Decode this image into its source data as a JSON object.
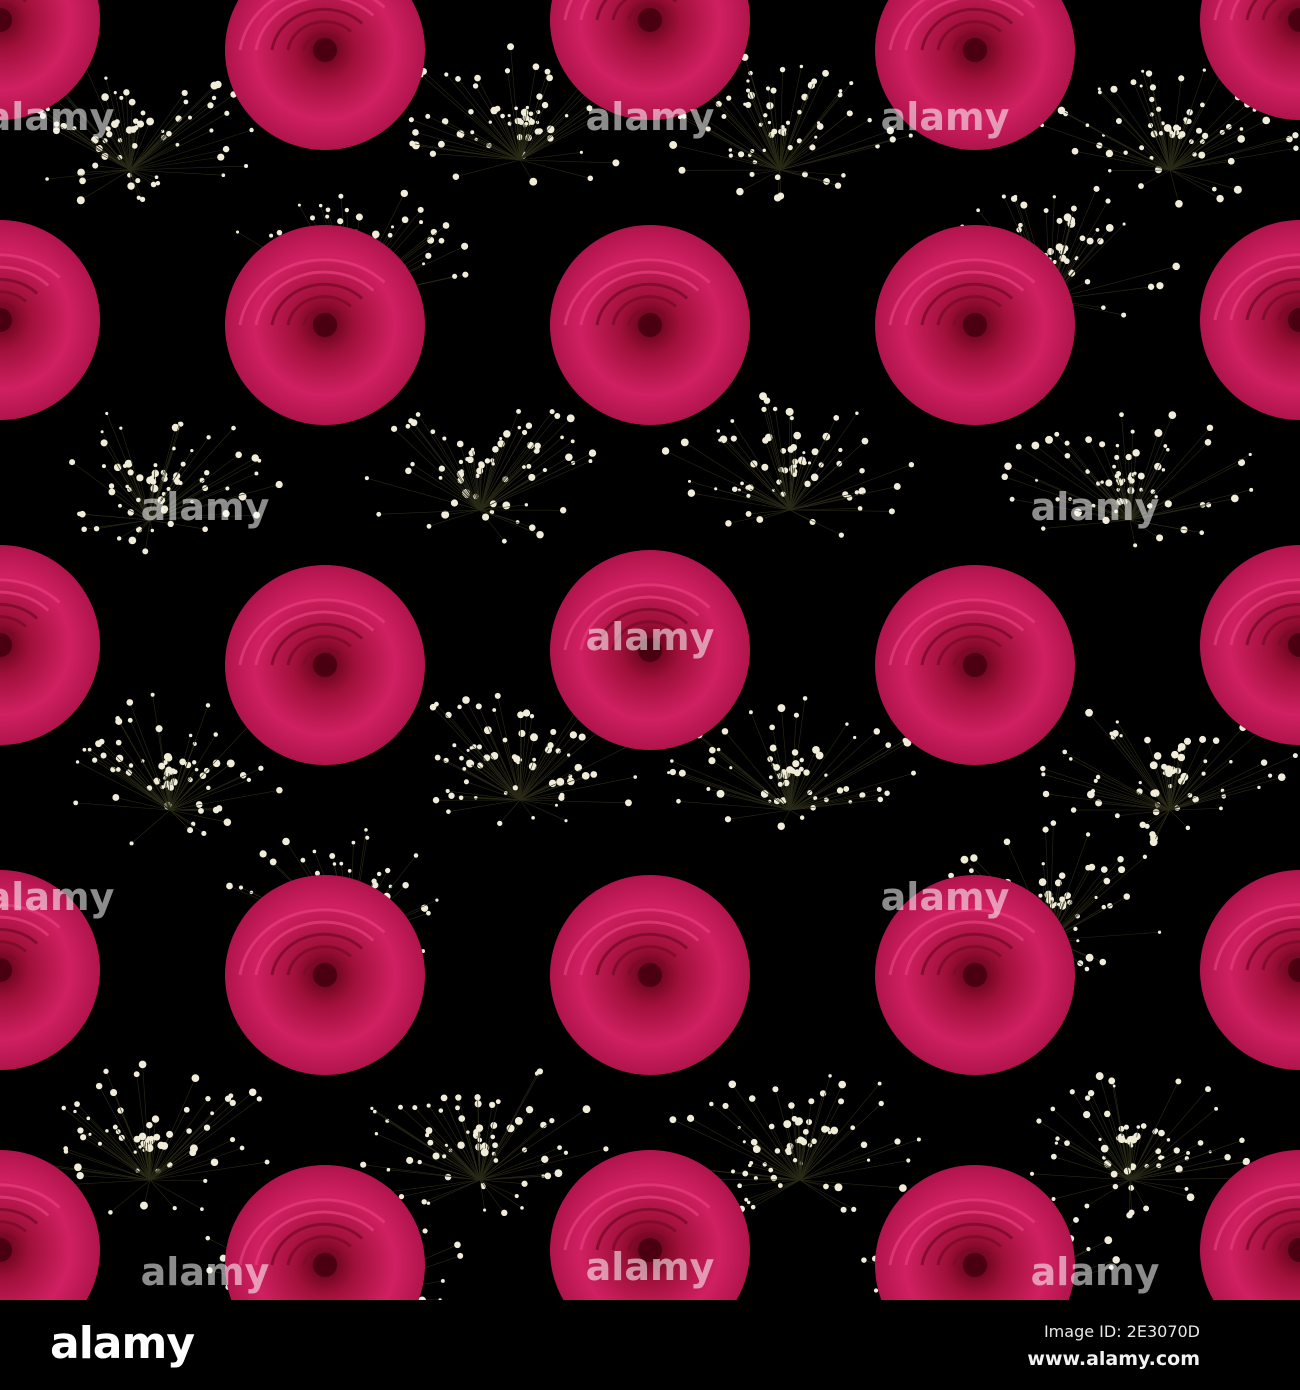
{
  "image": {
    "subject": "Seamless pattern of pink roses and baby's breath on black",
    "colors": {
      "background": "#000000",
      "rose_light": "#e0306e",
      "rose_mid": "#c0104a",
      "rose_dark": "#6a0018",
      "flower": "#f1ecd8"
    },
    "watermark": "alamy"
  },
  "footer": {
    "logo": "alamy",
    "image_id": "Image ID: 2E3070D",
    "site": "www.alamy.com"
  }
}
